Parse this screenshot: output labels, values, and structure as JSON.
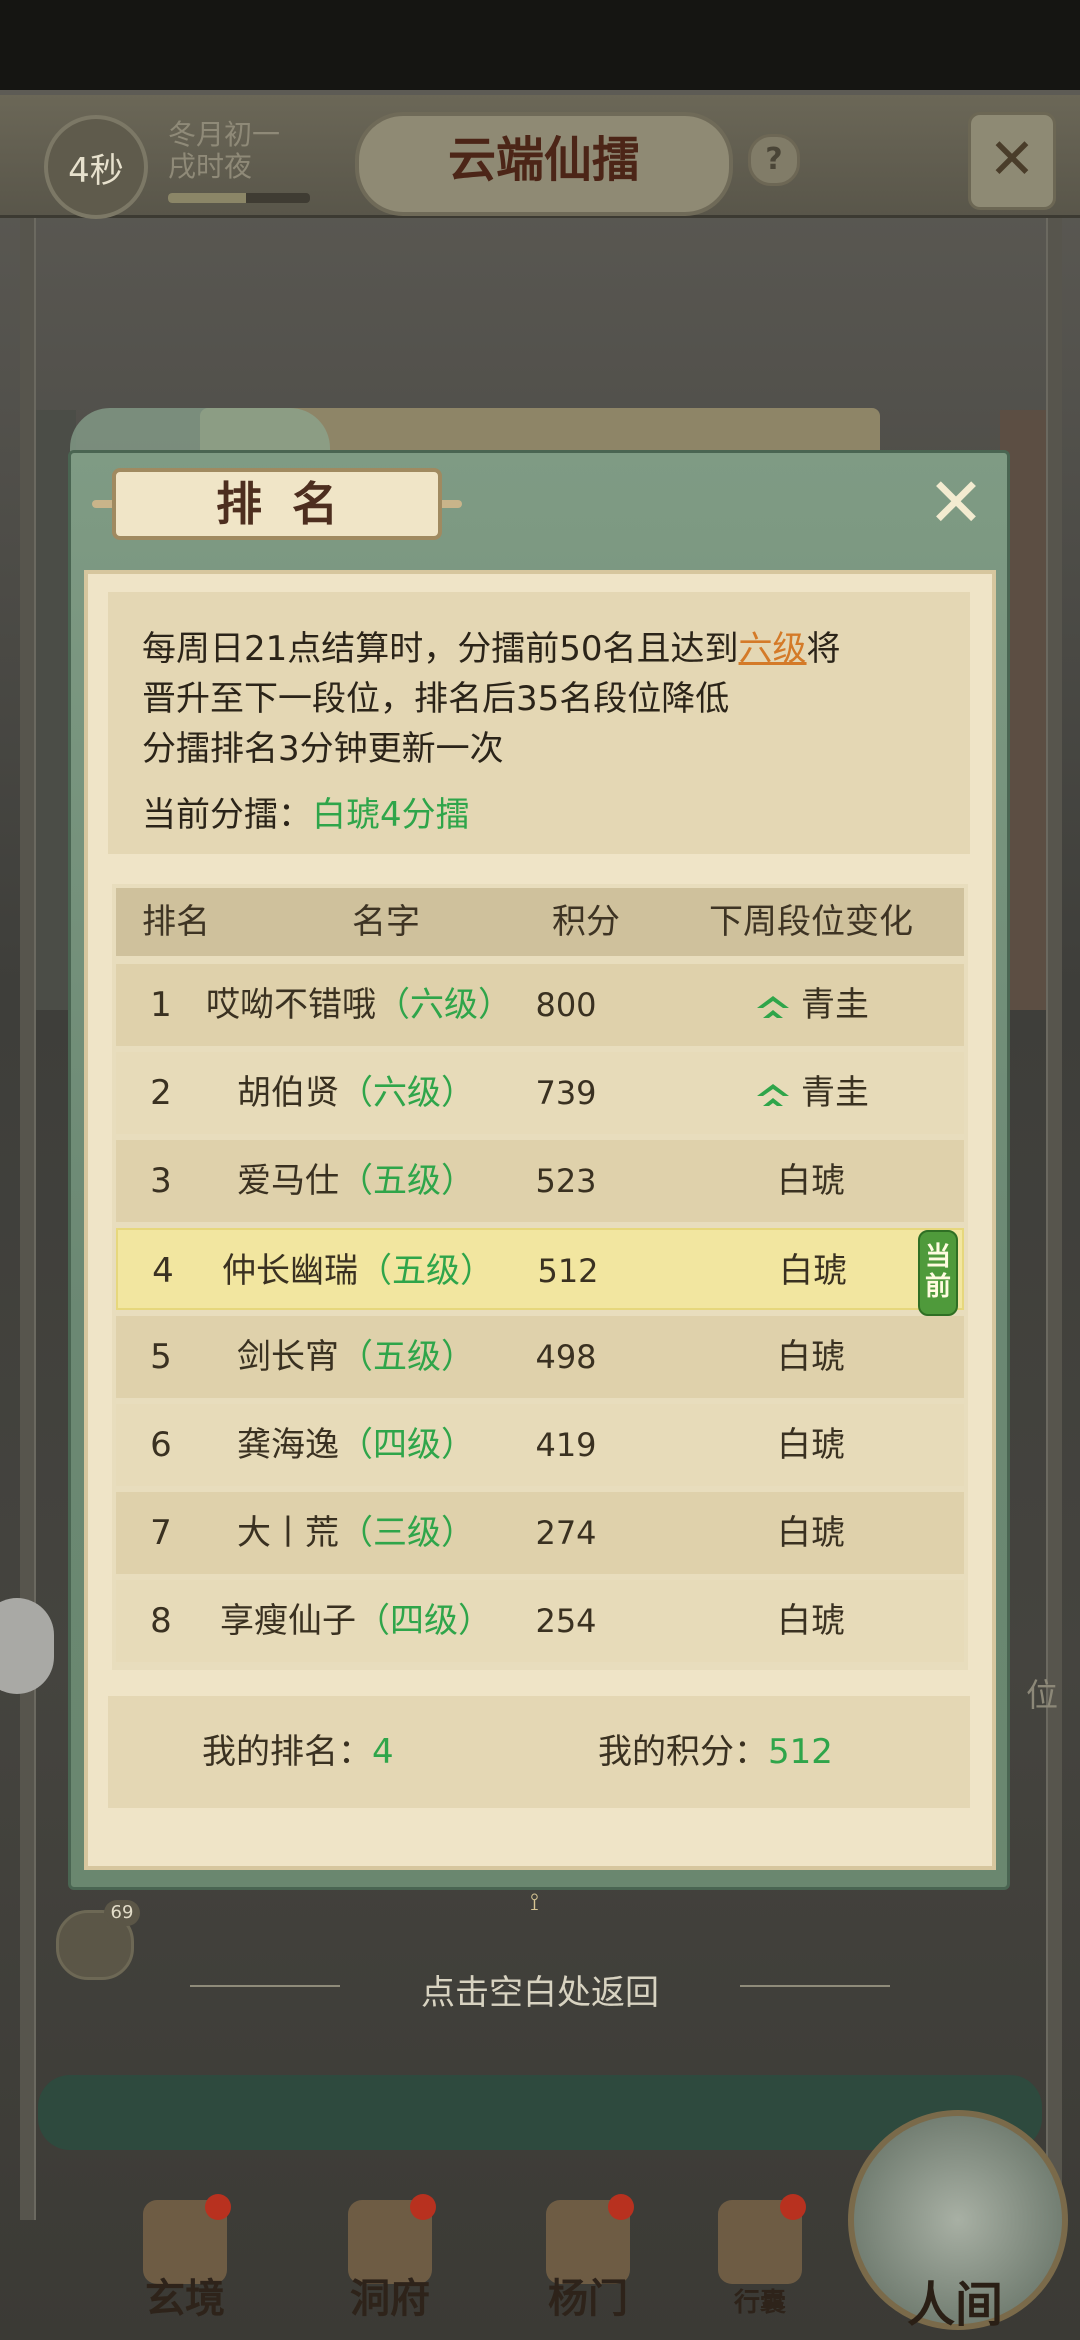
{
  "header": {
    "timer": "4秒",
    "date_line1": "冬月初一",
    "date_line2": "戌时夜",
    "date_progress": 0.55,
    "title": "云端仙擂",
    "help": "?"
  },
  "bottom_nav": [
    {
      "label": "玄境"
    },
    {
      "label": "洞府"
    },
    {
      "label": "杨门"
    },
    {
      "label": "行囊"
    }
  ],
  "human_world": "人间",
  "background_side_text": "位",
  "chat_count": "69",
  "dismiss_hint": "点击空白处返回",
  "modal": {
    "title": "排名",
    "notice": {
      "line1_before": "每周日21点结算时，分擂前50名且达到",
      "line1_highlight": "六级",
      "line1_after": "将",
      "line2": "晋升至下一段位，排名后35名段位降低",
      "line3": "分擂排名3分钟更新一次",
      "current_label": "当前分擂：",
      "current_value": "白琥4分擂"
    },
    "columns": [
      "排名",
      "名字",
      "积分",
      "下周段位变化"
    ],
    "rows": [
      {
        "rank": "1",
        "name": "哎呦不错哦",
        "level": "（六级）",
        "score": "800",
        "change": "青圭",
        "up": true
      },
      {
        "rank": "2",
        "name": "胡伯贤",
        "level": "（六级）",
        "score": "739",
        "change": "青圭",
        "up": true
      },
      {
        "rank": "3",
        "name": "爱马仕",
        "level": "（五级）",
        "score": "523",
        "change": "白琥",
        "up": false
      },
      {
        "rank": "4",
        "name": "仲长幽瑞",
        "level": "（五级）",
        "score": "512",
        "change": "白琥",
        "up": false,
        "current": true
      },
      {
        "rank": "5",
        "name": "剑长宵",
        "level": "（五级）",
        "score": "498",
        "change": "白琥",
        "up": false
      },
      {
        "rank": "6",
        "name": "龚海逸",
        "level": "（四级）",
        "score": "419",
        "change": "白琥",
        "up": false
      },
      {
        "rank": "7",
        "name": "大丨荒",
        "level": "（三级）",
        "score": "274",
        "change": "白琥",
        "up": false
      },
      {
        "rank": "8",
        "name": "享瘦仙子",
        "level": "（四级）",
        "score": "254",
        "change": "白琥",
        "up": false
      }
    ],
    "current_tag": "当前",
    "summary": {
      "my_rank_label": "我的排名：",
      "my_rank_value": "4",
      "my_score_label": "我的积分：",
      "my_score_value": "512"
    }
  },
  "colors": {
    "accent_green": "#2fa54a",
    "highlight_orange": "#d47a28",
    "modal_frame": "#6b8873"
  }
}
